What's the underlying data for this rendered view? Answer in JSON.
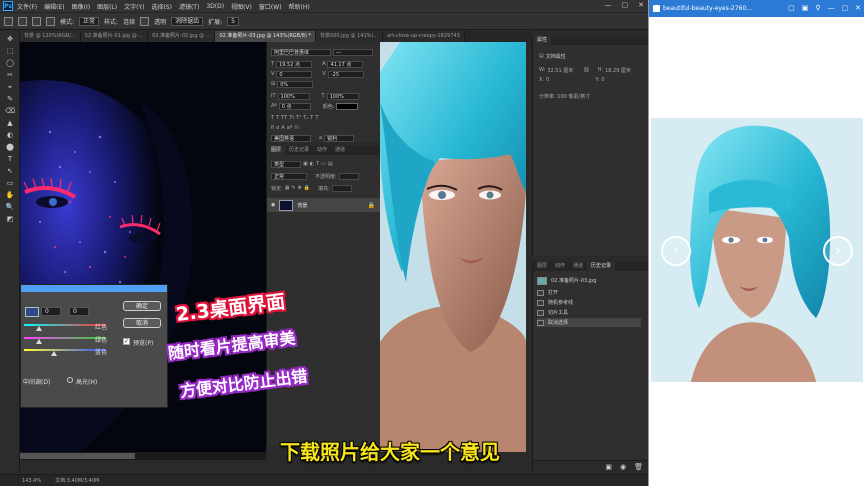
{
  "menubar": {
    "items": [
      "文件(F)",
      "编辑(E)",
      "图像(I)",
      "图层(L)",
      "文字(Y)",
      "选择(S)",
      "滤镜(T)",
      "3D(D)",
      "视图(V)",
      "窗口(W)",
      "帮助(H)"
    ],
    "controls": [
      "—",
      "▢",
      "✕"
    ]
  },
  "options": {
    "blend_label": "模式:",
    "blend_value": "正常",
    "refine_label": "样式:",
    "contiguous_label": "连续",
    "sample_label": "透明",
    "antialias_label": "消除锯齿",
    "spread_label": "扩展:",
    "spread_value": "5"
  },
  "tabs": [
    {
      "label": "背景 @ 120%(RGB/...",
      "active": false
    },
    {
      "label": "02.准备照片-01.jpg @ ...",
      "active": false
    },
    {
      "label": "02.准备照片-02.jpg @ ...",
      "active": false
    },
    {
      "label": "02.准备照片-03.jpg @ 143%(RGB/8) *",
      "active": true
    },
    {
      "label": "背景000.jpg @ 141%(...",
      "active": false
    },
    {
      "label": "art-close-up-creepy-1829743",
      "active": false
    }
  ],
  "tools": [
    "✥",
    "⬚",
    "◯",
    "✂",
    "⌖",
    "✎",
    "⌫",
    "▲",
    "◐",
    "⬤",
    "T",
    "↖",
    "▭",
    "✋",
    "🔍",
    "◩"
  ],
  "character": {
    "font_name": "阿里巴巴普惠体",
    "font_style": "—",
    "size": "19.52 点",
    "leading": "41.17 点",
    "kerning": "0",
    "tracking": "-25",
    "scale_pct": "0%",
    "vscale": "100%",
    "hscale": "100%",
    "baseline": "0 点",
    "color_label": "颜色:",
    "lang": "美国英语",
    "aa": "a",
    "aa_value": "锐利"
  },
  "layers": {
    "tabs": [
      "图层",
      "历史记录",
      "动作",
      "通道"
    ],
    "filter_label": "类型",
    "mode_value": "正常",
    "opacity_label": "不透明度:",
    "lock_label": "锁定:",
    "fill_label": "填充:",
    "layer_name": "背景"
  },
  "props": {
    "tab": "属性",
    "section": "文档属性",
    "w_label": "W:",
    "w_value": "32.51 厘米",
    "h_label": "H:",
    "h_value": "18.29 厘米",
    "x_label": "X:",
    "x_value": "0",
    "y_label": "Y:",
    "y_value": "0",
    "res": "分辨率: 100 像素/英寸"
  },
  "history": {
    "tabs": [
      "图层",
      "动作",
      "通道",
      "历史记录"
    ],
    "snapshot": "02.准备照片-03.jpg",
    "items": [
      "打开",
      "随机参考线",
      "切片工具",
      "取消选择"
    ]
  },
  "status": {
    "zoom": "143.4%",
    "doc": "文档:3.40M/3.40M"
  },
  "dialog": {
    "ok": "确定",
    "cancel": "取消",
    "preview": "预览(P)",
    "red": "红色",
    "green": "绿色",
    "blue": "蓝色",
    "midtones": "中间调(D)",
    "highlights": "高光(H)",
    "field1": "0",
    "field2": "0"
  },
  "overlay": {
    "line1": "2.3桌面界面",
    "line2": "随时看片提高审美",
    "line3": "方便对比防止出错",
    "subtitle": "下载照片给大家一个意见"
  },
  "viewer": {
    "title": "beautiful-beauty-eyes-2760...",
    "controls": [
      "▢",
      "▣",
      "⚲",
      "—",
      "▢",
      "✕"
    ],
    "prev": "‹",
    "next": "›"
  },
  "colors": {
    "ps_bg": "#2a2a2a",
    "accent_blue": "#2b7bd6",
    "subtitle_yellow": "#f6e51a",
    "overlay_red": "#e2133a",
    "overlay_purple": "#9a2ac8",
    "hair_cyan": "#27b7d4"
  }
}
